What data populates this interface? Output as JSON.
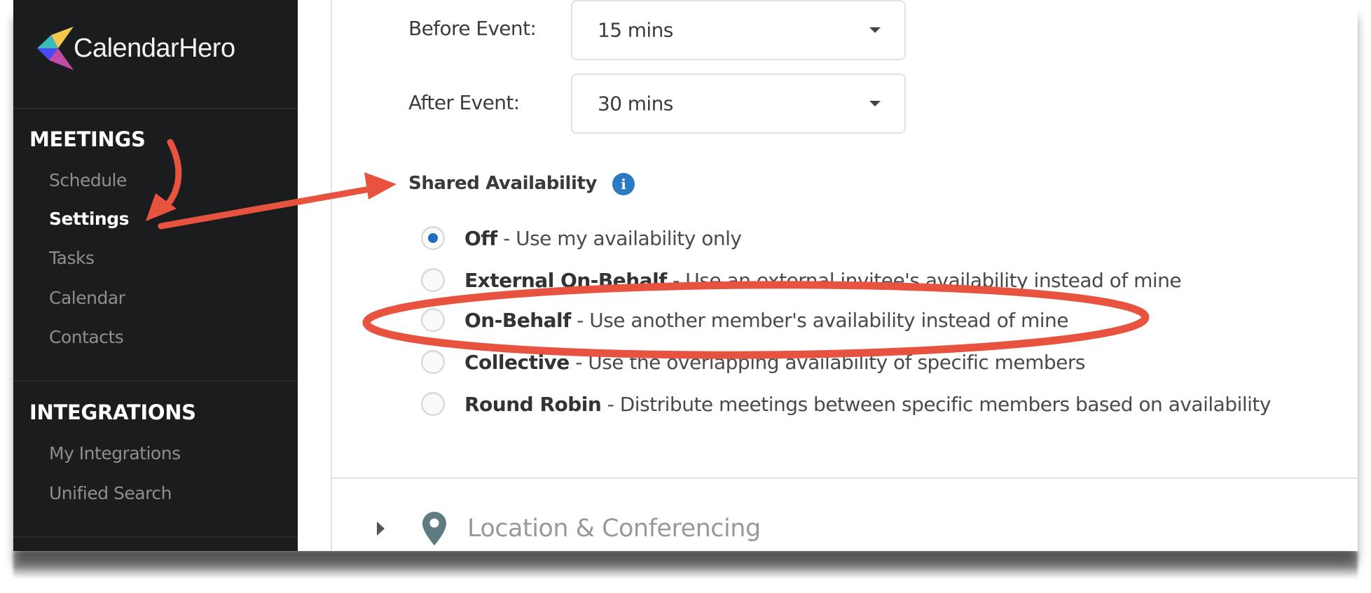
{
  "app": {
    "name": "CalendarHero",
    "logo_colors": [
      "#f2c94c",
      "#3bbcb8",
      "#4b4bf5",
      "#c24ba5"
    ]
  },
  "sidebar": {
    "sections": [
      {
        "heading": "MEETINGS",
        "items": [
          {
            "label": "Schedule",
            "active": false
          },
          {
            "label": "Settings",
            "active": true
          },
          {
            "label": "Tasks",
            "active": false
          },
          {
            "label": "Calendar",
            "active": false
          },
          {
            "label": "Contacts",
            "active": false
          }
        ]
      },
      {
        "heading": "INTEGRATIONS",
        "items": [
          {
            "label": "My Integrations",
            "active": false
          },
          {
            "label": "Unified Search",
            "active": false
          }
        ]
      }
    ]
  },
  "buffers": {
    "before": {
      "label": "Before Event:",
      "value": "15 mins"
    },
    "after": {
      "label": "After Event:",
      "value": "30 mins"
    }
  },
  "shared_availability": {
    "title": "Shared Availability",
    "info_icon": "info-icon",
    "selected": "Off",
    "options": [
      {
        "name": "Off",
        "separator": " - ",
        "description": "Use my availability only",
        "checked": true
      },
      {
        "name": "External On-Behalf",
        "separator": " - ",
        "description": "Use an external invitee's availability instead of mine",
        "checked": false
      },
      {
        "name": "On-Behalf",
        "separator": " - ",
        "description": "Use another member's availability instead of mine",
        "checked": false
      },
      {
        "name": "Collective",
        "separator": " - ",
        "description": "Use the overlapping availability of specific members",
        "checked": false
      },
      {
        "name": "Round Robin",
        "separator": " - ",
        "description": "Distribute meetings between specific members based on availability",
        "checked": false
      }
    ]
  },
  "location_section": {
    "title": "Location & Conferencing",
    "expanded": false
  },
  "annotations": {
    "color": "#e8533f",
    "highlighted_option": "On-Behalf",
    "arrows": [
      "curved arrow pointing to Settings",
      "arrow from Settings to Shared Availability"
    ]
  }
}
